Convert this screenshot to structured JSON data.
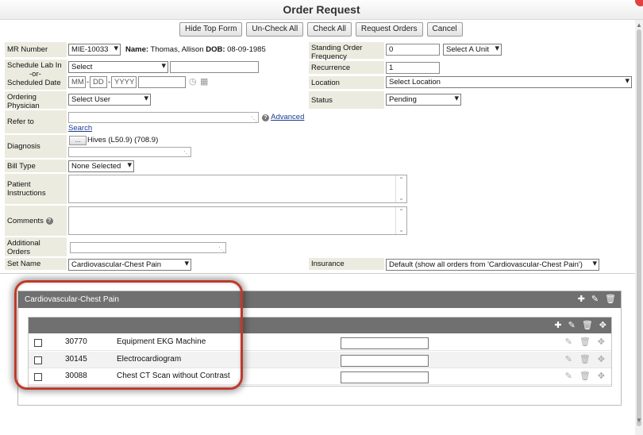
{
  "window": {
    "title": "Order Request"
  },
  "toolbar": {
    "hide_top_form": "Hide Top Form",
    "uncheck_all": "Un-Check All",
    "check_all": "Check All",
    "request_orders": "Request Orders",
    "cancel": "Cancel"
  },
  "form": {
    "mr_number": {
      "label": "MR Number",
      "value": "MIE-10033"
    },
    "patient": {
      "name_label": "Name:",
      "name_value": "Thomas, Allison",
      "dob_label": "DOB:",
      "dob_value": "08-09-1985"
    },
    "schedule": {
      "label_line1": "Schedule Lab In",
      "label_line2": "-or-",
      "label_line3": "Scheduled Date",
      "select_value": "Select",
      "mm": "MM",
      "dd": "DD",
      "yyyy": "YYYY"
    },
    "ordering_physician": {
      "label_line1": "Ordering",
      "label_line2": "Physician",
      "value": "Select User"
    },
    "refer_to": {
      "label": "Refer to",
      "advanced_link": "Advanced",
      "search_link": "Search"
    },
    "diagnosis": {
      "label": "Diagnosis",
      "button_label": "...",
      "value": "Hives (L50.9) (708.9)"
    },
    "bill_type": {
      "label": "Bill Type",
      "value": "None Selected"
    },
    "patient_instructions": {
      "label_line1": "Patient",
      "label_line2": "Instructions"
    },
    "comments": {
      "label": "Comments",
      "help": "?"
    },
    "additional_orders": {
      "label_line1": "Additional",
      "label_line2": "Orders"
    },
    "set_name": {
      "label": "Set Name",
      "value": "Cardiovascular-Chest Pain"
    },
    "standing_order": {
      "label_line1": "Standing Order",
      "label_line2": "Frequency",
      "value": "0",
      "unit": "Select A Unit"
    },
    "recurrence": {
      "label": "Recurrence",
      "value": "1"
    },
    "location": {
      "label": "Location",
      "value": "Select Location"
    },
    "status": {
      "label": "Status",
      "value": "Pending"
    },
    "insurance": {
      "label": "Insurance",
      "value": "Default (show all orders from 'Cardiovascular-Chest Pain')"
    }
  },
  "order_set": {
    "title": "Cardiovascular-Chest Pain",
    "orders": [
      {
        "code": "30770",
        "name": "Equipment EKG Machine"
      },
      {
        "code": "30145",
        "name": "Electrocardiogram"
      },
      {
        "code": "30088",
        "name": "Chest CT Scan without Contrast"
      }
    ]
  },
  "colors": {
    "label_bg": "#ecebe0",
    "header_gray": "#707070",
    "highlight": "#c0392b"
  }
}
